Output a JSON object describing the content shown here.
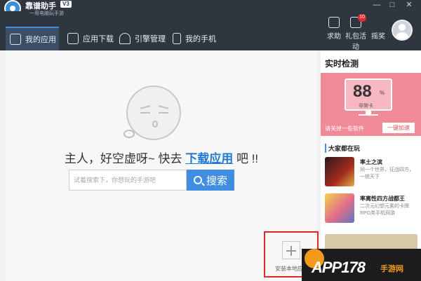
{
  "app": {
    "brand_text": "靠谱助手",
    "brand_sub": "一用电脑玩手游",
    "version": "V3"
  },
  "window_controls": [
    "—",
    "□",
    "✕"
  ],
  "nav": {
    "tabs": [
      {
        "label": "我的应用",
        "icon": "home-icon",
        "active": true
      },
      {
        "label": "应用下载",
        "icon": "download-icon",
        "active": false
      },
      {
        "label": "引擎管理",
        "icon": "android-icon",
        "active": false
      },
      {
        "label": "我的手机",
        "icon": "phone-icon",
        "active": false
      }
    ],
    "right": [
      {
        "label": "求助",
        "icon": "help-icon"
      },
      {
        "label": "礼包活动",
        "icon": "gift-icon",
        "badge": "10"
      },
      {
        "label": "摇奖",
        "icon": "lottery-icon"
      }
    ]
  },
  "main": {
    "empty_prefix": "主人，好空虚呀~ 快去",
    "empty_link": "下载应用",
    "empty_suffix": "吧 !!",
    "search_placeholder": "试着搜索下，你想玩的手游吧",
    "search_button": "搜索",
    "install_label": "安装本地应"
  },
  "sidebar": {
    "realtime_title": "实时检测",
    "score": "88",
    "score_unit": "%",
    "score_label": "非常卡",
    "hint": "请关掉一些软件",
    "speed_button": "一键加速",
    "section_title": "大家都在玩",
    "games": [
      {
        "name": "率土之滨",
        "desc": "同一个世界，征战四方，一统天下"
      },
      {
        "name": "率离性四方战都王",
        "desc": "二次元幻想元素的卡牌RPG类手机网游"
      }
    ]
  },
  "watermark": {
    "text": "APP178",
    "sub": "手游网"
  }
}
